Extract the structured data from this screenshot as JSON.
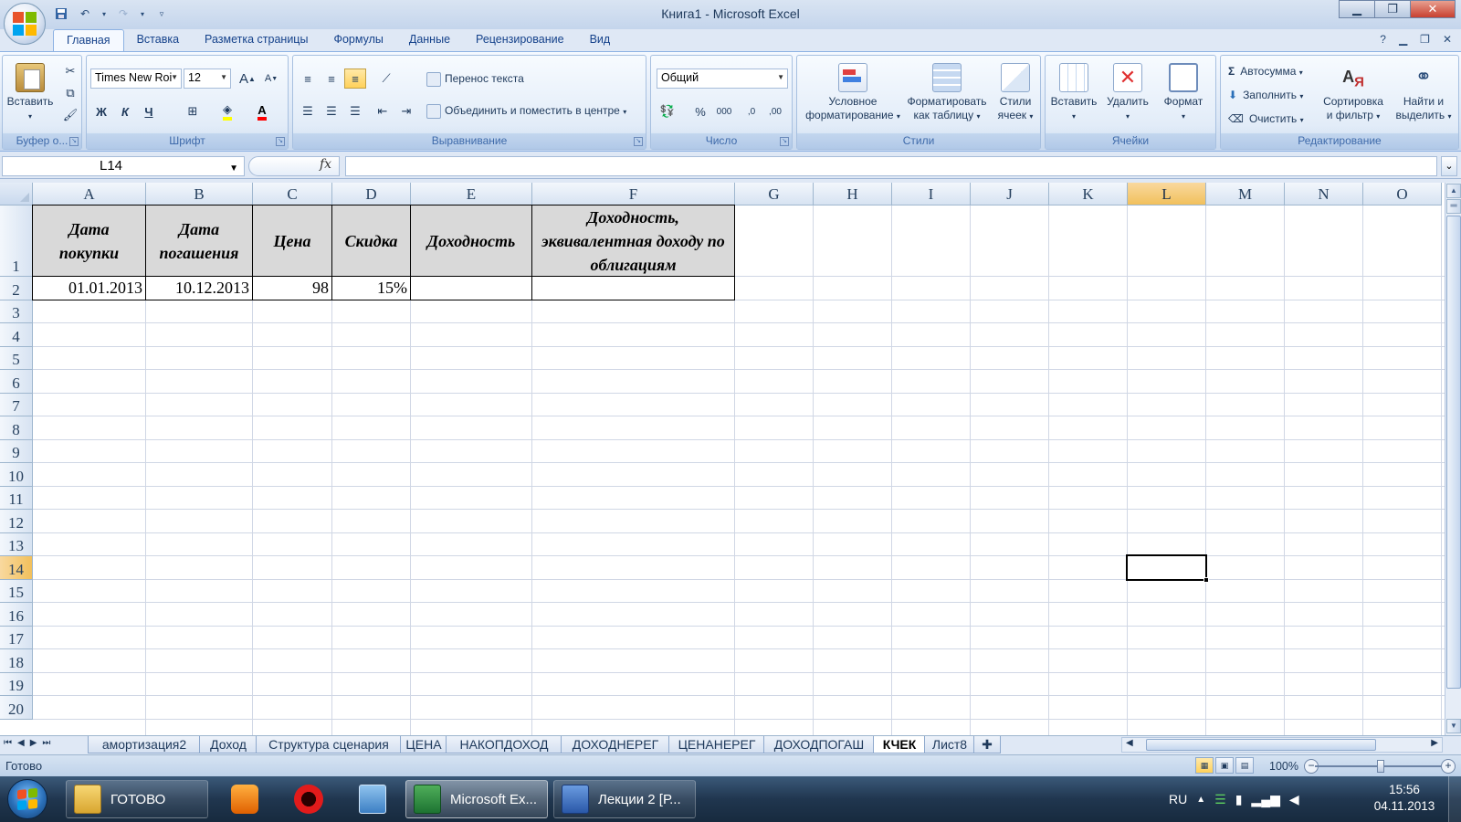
{
  "window": {
    "title": "Книга1 - Microsoft Excel",
    "minimize": "▁",
    "maximize": "❐",
    "close": "✕"
  },
  "ribbon_tabs": [
    "Главная",
    "Вставка",
    "Разметка страницы",
    "Формулы",
    "Данные",
    "Рецензирование",
    "Вид"
  ],
  "ribbon": {
    "clipboard": {
      "label": "Буфер о...",
      "paste": "Вставить"
    },
    "font": {
      "label": "Шрифт",
      "name": "Times New Roi",
      "size": "12",
      "bold": "Ж",
      "italic": "К",
      "underline": "Ч",
      "grow": "A",
      "shrink": "A"
    },
    "alignment": {
      "label": "Выравнивание",
      "wrap": "Перенос текста",
      "merge": "Объединить и поместить в центре"
    },
    "number": {
      "label": "Число",
      "format": "Общий",
      "percent": "%",
      "thousands": "000",
      "inc_dec": ",0",
      "dec_dec": ",00"
    },
    "styles": {
      "label": "Стили",
      "conditional_1": "Условное",
      "conditional_2": "форматирование",
      "table_1": "Форматировать",
      "table_2": "как таблицу",
      "cell_1": "Стили",
      "cell_2": "ячеек"
    },
    "cells": {
      "label": "Ячейки",
      "insert": "Вставить",
      "delete": "Удалить",
      "format": "Формат"
    },
    "editing": {
      "label": "Редактирование",
      "autosum": "Автосумма",
      "fill": "Заполнить",
      "clear": "Очистить",
      "sort_1": "Сортировка",
      "sort_2": "и фильтр",
      "find_1": "Найти и",
      "find_2": "выделить"
    }
  },
  "formula_bar": {
    "name_box": "L14",
    "fx": "fx",
    "formula": ""
  },
  "columns": [
    "A",
    "B",
    "C",
    "D",
    "E",
    "F",
    "G",
    "H",
    "I",
    "J",
    "K",
    "L",
    "M",
    "N",
    "O"
  ],
  "selected_column": "L",
  "rows": [
    "1",
    "2",
    "3",
    "4",
    "5",
    "6",
    "7",
    "8",
    "9",
    "10",
    "11",
    "12",
    "13",
    "14",
    "15",
    "16",
    "17",
    "18",
    "19",
    "20"
  ],
  "selected_row": "14",
  "table": {
    "headers": [
      "Дата покупки",
      "Дата погашения",
      "Цена",
      "Скидка",
      "Доходность",
      "Доходность, эквивалентная доходу по облигациям"
    ],
    "row2": [
      "01.01.2013",
      "10.12.2013",
      "98",
      "15%",
      "",
      ""
    ]
  },
  "sheet_tabs": [
    "амортизация2",
    "Доход",
    "Структура сценария",
    "ЦЕНА",
    "НАКОПДОХОД",
    "ДОХОДНЕРЕГ",
    "ЦЕНАНЕРЕГ",
    "ДОХОДПОГАШ",
    "КЧЕК",
    "Лист8"
  ],
  "active_sheet": "КЧЕК",
  "status": {
    "ready": "Готово",
    "zoom": "100%"
  },
  "taskbar": {
    "items": [
      "ГОТОВО",
      "Microsoft Ex...",
      "Лекции 2 [Р..."
    ],
    "lang": "RU",
    "time": "15:56",
    "date": "04.11.2013"
  },
  "colors": {
    "header_fill": "#d9d9d9",
    "selection_header": "#f1c05c",
    "ribbon_bg": "#dae6f5"
  }
}
